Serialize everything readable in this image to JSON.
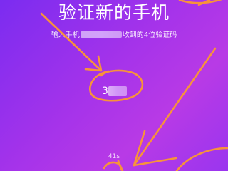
{
  "title": "验证新的手机",
  "hint": {
    "prefix": "输入手机",
    "masked_number": "",
    "middle": "收到的",
    "digit": "4",
    "suffix": "位验证码"
  },
  "code_input": {
    "value": "3"
  },
  "countdown": "41s",
  "colors": {
    "background_start": "#7b2cf0",
    "background_end": "#b83ae6",
    "annotation": "#f7933a",
    "text": "#ffffff"
  }
}
